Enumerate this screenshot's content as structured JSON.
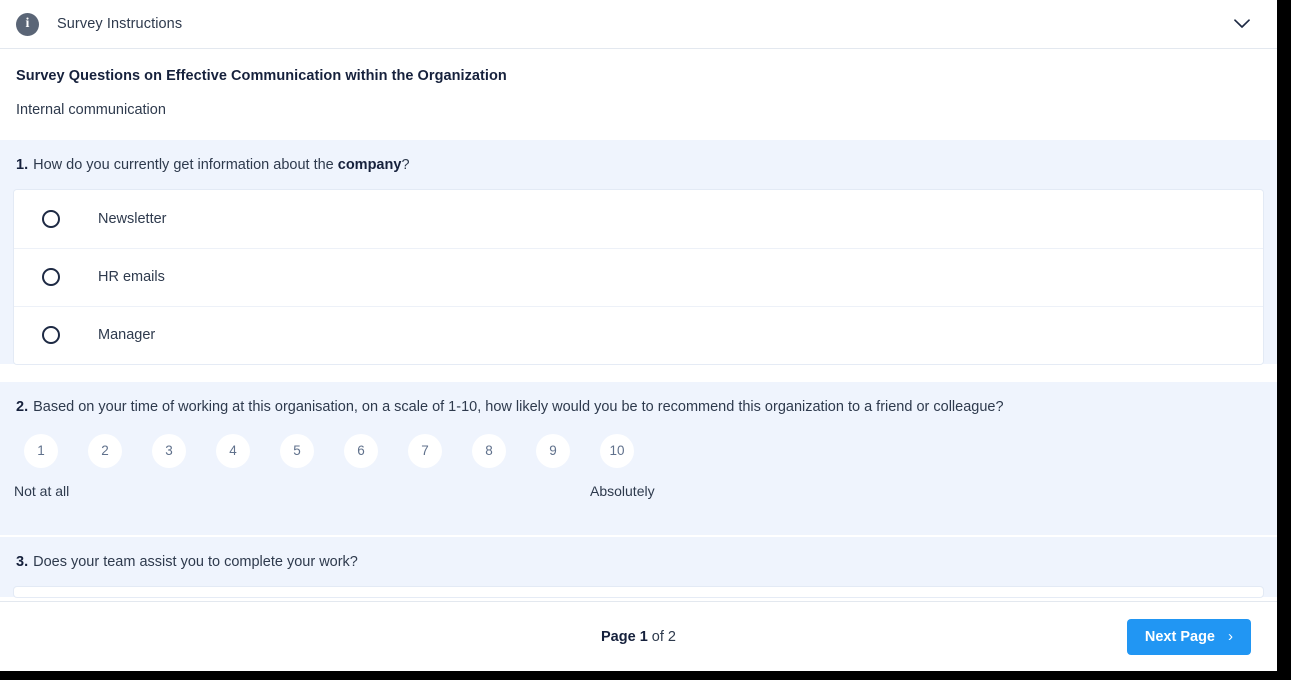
{
  "header": {
    "icon": "info-icon",
    "title": "Survey Instructions",
    "toggle_icon": "chevron-down-icon"
  },
  "intro": {
    "heading": "Survey Questions on Effective Communication within the Organization",
    "subheading": "Internal communication"
  },
  "questions": [
    {
      "number": "1.",
      "text_before": "How do you currently get information about the ",
      "text_bold": "company",
      "text_after": "?",
      "type": "radio",
      "options": [
        {
          "label": "Newsletter"
        },
        {
          "label": "HR emails"
        },
        {
          "label": "Manager"
        }
      ]
    },
    {
      "number": "2.",
      "text_before": "Based on your time of working at this organisation, on a scale of 1-10, how likely would you be to recommend this organization to a friend or colleague?",
      "text_bold": "",
      "text_after": "",
      "type": "rating",
      "scale": [
        "1",
        "2",
        "3",
        "4",
        "5",
        "6",
        "7",
        "8",
        "9",
        "10"
      ],
      "low_label": "Not at all",
      "high_label": "Absolutely"
    },
    {
      "number": "3.",
      "text_before": "Does your team assist you to complete your work?",
      "text_bold": "",
      "text_after": "",
      "type": "radio-clipped",
      "options": []
    }
  ],
  "footer": {
    "page_prefix": "Page ",
    "current_page": "1",
    "page_suffix": " of 2",
    "next_label": "Next Page",
    "next_icon": "chevron-right-icon"
  },
  "colors": {
    "accent": "#2196f3",
    "question_bg": "#eff4fd",
    "text": "#2e3a4d",
    "heading": "#16213c",
    "icon_bg": "#5a6576"
  }
}
